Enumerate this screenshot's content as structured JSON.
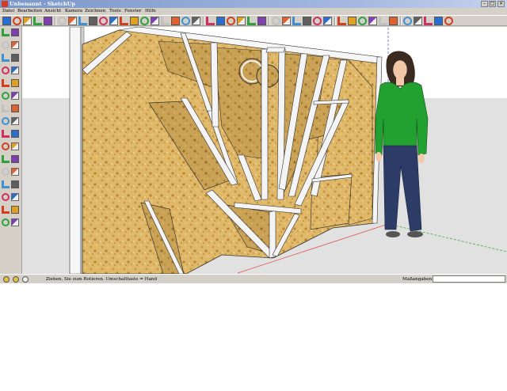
{
  "window": {
    "title": "Unbenannt - SketchUp"
  },
  "menu": [
    "Datei",
    "Bearbeiten",
    "Ansicht",
    "Kamera",
    "Zeichnen",
    "Tools",
    "Fenster",
    "Hilfe"
  ],
  "toolbar": {
    "icons": [
      "select-icon",
      "pencil-icon",
      "rectangle-icon",
      "cube-icon",
      "arc-icon",
      "eraser-icon",
      "paint-bucket-icon",
      "push-pull-icon",
      "move-icon",
      "rotate-icon",
      "follow-me-icon",
      "scale-icon",
      "offset-icon",
      "tape-measure-icon",
      "protractor-icon",
      "text-icon",
      "axes-icon",
      "dimension-icon",
      "section-plane-icon",
      "orbit-icon",
      "pan-icon",
      "zoom-icon",
      "zoom-window-icon",
      "zoom-extents-icon",
      "previous-view-icon",
      "iso-view-icon",
      "top-view-icon",
      "front-view-icon",
      "right-view-icon",
      "back-view-icon",
      "left-view-icon",
      "xray-icon",
      "wireframe-icon",
      "hidden-line-icon",
      "shaded-icon",
      "shaded-texture-icon",
      "monochrome-icon",
      "components-icon",
      "materials-icon",
      "get-models-icon",
      "share-model-icon",
      "warehouse-icon"
    ]
  },
  "left_toolbar": {
    "icons": [
      "select-icon",
      "paint-icon",
      "pencil-icon",
      "eraser-icon",
      "rectangle-icon",
      "line-icon",
      "circle-icon",
      "arc-icon",
      "polygon-icon",
      "freehand-icon",
      "move-icon",
      "push-pull-icon",
      "rotate-icon",
      "follow-me-icon",
      "scale-icon",
      "offset-icon",
      "tape-measure-icon",
      "dimension-icon",
      "protractor-icon",
      "text-icon",
      "axes-icon",
      "3d-text-icon",
      "orbit-icon",
      "pan-icon",
      "zoom-icon",
      "zoom-window-icon",
      "zoom-extents-icon",
      "previous-icon",
      "position-camera-icon",
      "look-around-icon",
      "walk-icon",
      "section-plane-icon"
    ]
  },
  "status": {
    "hint": "Ziehen, Sie zum Rotieren.  Umschalttaste = Hand",
    "measure_label": "Maßangaben",
    "measure_value": ""
  },
  "colors": {
    "sky": "#ffffff",
    "ground": "#e1e1e1",
    "osb": "#e0b86a",
    "frame": "#f4f4f4",
    "axis_red": "#e05050",
    "axis_green": "#40b040",
    "axis_blue": "#5060e0",
    "shirt": "#22a030",
    "jeans": "#2c3c66"
  }
}
